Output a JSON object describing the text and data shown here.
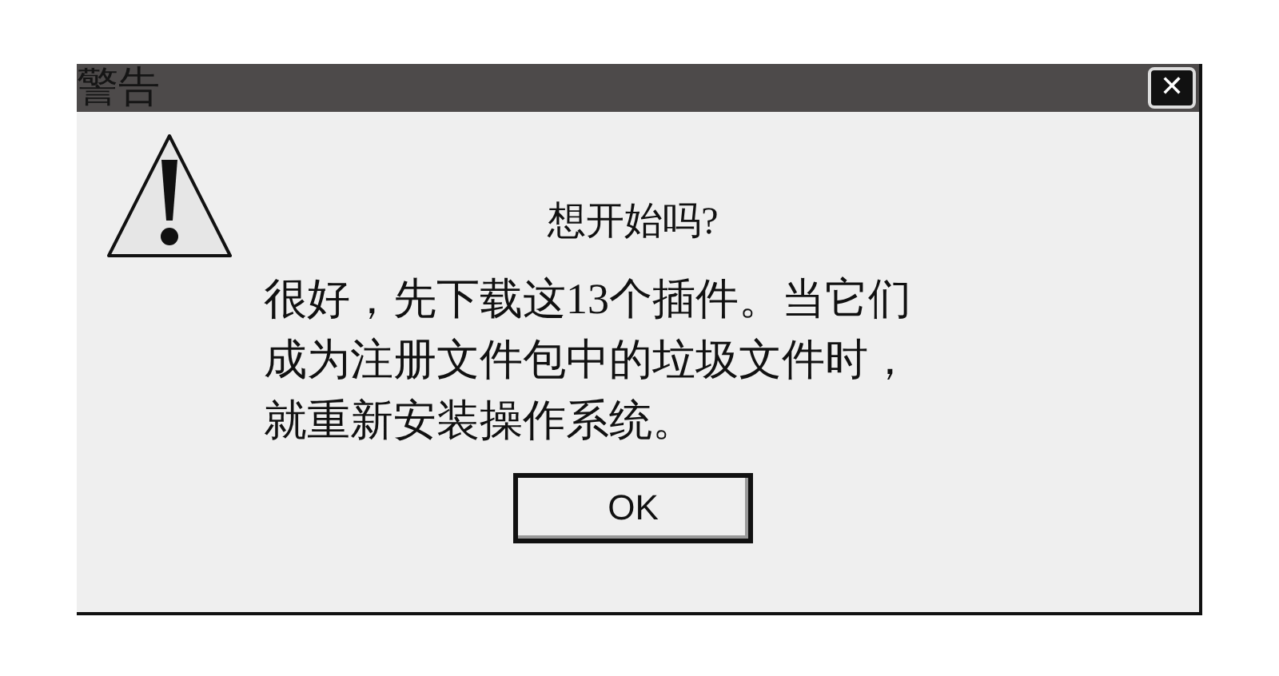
{
  "window": {
    "title": "警告",
    "close_label": "✕"
  },
  "message": {
    "heading": "想开始吗?",
    "lines": [
      "很好，先下载这13个插件。当它们",
      "成为注册文件包中的垃圾文件时，",
      "就重新安装操作系统。"
    ]
  },
  "buttons": [
    "OK"
  ]
}
